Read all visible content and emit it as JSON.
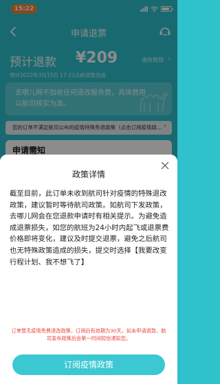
{
  "status_bar": {
    "time": "15:22"
  },
  "nav": {
    "title": "申请退票"
  },
  "refund": {
    "label": "预计退款",
    "amount": "¥209",
    "rule_link": "退改规则",
    "rule_arrow": "›"
  },
  "expect_time": "预计2022年3月15日 17:22点前退款完成",
  "info_card": {
    "text": "去哪儿网不加收任何退改服务费，具体费用以航司核实为准。"
  },
  "notice": {
    "text": "您的订单不满足航司公布的疫情特殊免退政策（点击订阅疫情政...",
    "arrow": "›"
  },
  "section": {
    "title": "申请需知"
  },
  "sheet": {
    "title": "政策详情",
    "body": "截至目前，此订单未收到航司针对疫情的特殊退改政策，建议暂时等待航司政策。如航司下发政策，去哪儿网会在您退款申请时有相关提示。为避免造成退票损失，如您的航班为24小时内起飞或退票费价格即将变化，建议及时提交退票，避免之后航司也无特殊政策造成的损失，提交时选择【我要改变行程计划、我不想飞了】",
    "footer": "订单暂无疫情免费退改政策，订阅后有效期为30天，如未申请退款，航司发布政策后会第一时间短信通知您。",
    "button": "订阅疫情政策"
  },
  "colors": {
    "brand": "#2fc1cc",
    "button": "#3cc8d3",
    "warning": "#e8453c",
    "status_pill": "#f2853a"
  }
}
